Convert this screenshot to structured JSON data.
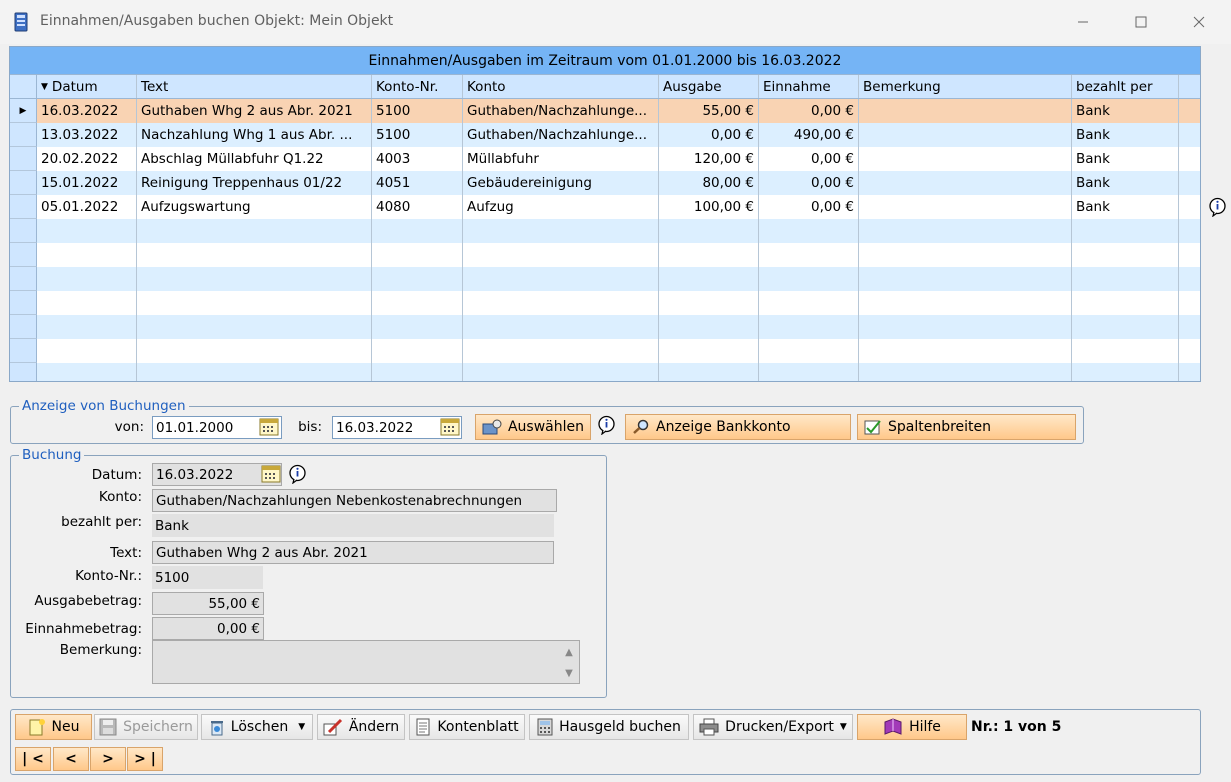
{
  "window": {
    "title": "Einnahmen/Ausgaben buchen  Objekt: Mein Objekt"
  },
  "grid": {
    "caption": "Einnahmen/Ausgaben im Zeitraum vom 01.01.2000 bis 16.03.2022",
    "columns": {
      "datum": "Datum",
      "text": "Text",
      "konto_nr": "Konto-Nr.",
      "konto": "Konto",
      "ausgabe": "Ausgabe",
      "einnahme": "Einnahme",
      "bemerkung": "Bemerkung",
      "bezahlt_per": "bezahlt per"
    },
    "rows": [
      {
        "datum": "16.03.2022",
        "text": "Guthaben Whg 2 aus Abr. 2021",
        "konto_nr": "5100",
        "konto": "Guthaben/Nachzahlunge...",
        "ausgabe": "55,00 €",
        "einnahme": "0,00 €",
        "bemerkung": "",
        "bezahlt_per": "Bank"
      },
      {
        "datum": "13.03.2022",
        "text": "Nachzahlung Whg 1 aus Abr. ...",
        "konto_nr": "5100",
        "konto": "Guthaben/Nachzahlunge...",
        "ausgabe": "0,00 €",
        "einnahme": "490,00 €",
        "bemerkung": "",
        "bezahlt_per": "Bank"
      },
      {
        "datum": "20.02.2022",
        "text": "Abschlag Müllabfuhr Q1.22",
        "konto_nr": "4003",
        "konto": "Müllabfuhr",
        "ausgabe": "120,00 €",
        "einnahme": "0,00 €",
        "bemerkung": "",
        "bezahlt_per": "Bank"
      },
      {
        "datum": "15.01.2022",
        "text": "Reinigung Treppenhaus 01/22",
        "konto_nr": "4051",
        "konto": "Gebäudereinigung",
        "ausgabe": "80,00 €",
        "einnahme": "0,00 €",
        "bemerkung": "",
        "bezahlt_per": "Bank"
      },
      {
        "datum": "05.01.2022",
        "text": "Aufzugswartung",
        "konto_nr": "4080",
        "konto": "Aufzug",
        "ausgabe": "100,00 €",
        "einnahme": "0,00 €",
        "bemerkung": "",
        "bezahlt_per": "Bank"
      }
    ]
  },
  "anzeige": {
    "legend": "Anzeige von Buchungen",
    "von_label": "von:",
    "von_value": "01.01.2000",
    "bis_label": "bis:",
    "bis_value": "16.03.2022",
    "btn_auswaehlen": "Auswählen",
    "btn_anzeige_bankkonto": "Anzeige Bankkonto",
    "btn_spaltenbreiten": "Spaltenbreiten"
  },
  "buchung": {
    "legend": "Buchung",
    "datum_label": "Datum:",
    "datum_value": "16.03.2022",
    "konto_label": "Konto:",
    "konto_value": "Guthaben/Nachzahlungen Nebenkostenabrechnungen",
    "bezahlt_label": "bezahlt per:",
    "bezahlt_value": "Bank",
    "text_label": "Text:",
    "text_value": "Guthaben Whg 2 aus Abr. 2021",
    "kontonr_label": "Konto-Nr.:",
    "kontonr_value": "5100",
    "ausgabe_label": "Ausgabebetrag:",
    "ausgabe_value": "55,00 €",
    "einnahme_label": "Einnahmebetrag:",
    "einnahme_value": "0,00 €",
    "bemerkung_label": "Bemerkung:",
    "bemerkung_value": ""
  },
  "toolbar": {
    "neu": "Neu",
    "speichern": "Speichern",
    "loeschen": "Löschen",
    "aendern": "Ändern",
    "kontenblatt": "Kontenblatt",
    "hausgeld": "Hausgeld buchen",
    "drucken": "Drucken/Export",
    "hilfe": "Hilfe",
    "record_info": "Nr.: 1 von 5",
    "nav_first": "| <",
    "nav_prev": "<",
    "nav_next": ">",
    "nav_last": "> |"
  },
  "colors": {
    "caption_bg": "#75b4f5",
    "header_bg": "#cfe6ff",
    "row_selected": "#f9d3b3",
    "row_alt": "#dcefff",
    "button_orange": "#ffc88a",
    "legend_blue": "#1f5fbf"
  }
}
